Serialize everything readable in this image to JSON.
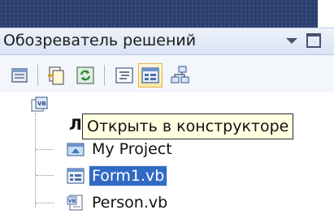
{
  "panel": {
    "title": "Обозреватель решений"
  },
  "toolbar": {
    "buttons": [
      {
        "name": "properties-icon"
      },
      {
        "name": "show-all-files-icon"
      },
      {
        "name": "refresh-icon"
      },
      {
        "name": "view-code-icon"
      },
      {
        "name": "view-designer-icon",
        "active": true
      },
      {
        "name": "class-diagram-icon"
      }
    ]
  },
  "tooltip": {
    "text": "Открыть в конструкторе"
  },
  "tree": {
    "root": {
      "label": "Л",
      "icon": "vb-project-icon"
    },
    "items": [
      {
        "label": "My Project",
        "icon": "my-project-icon",
        "selected": false
      },
      {
        "label": "Form1.vb",
        "icon": "form-icon",
        "selected": true
      },
      {
        "label": "Person.vb",
        "icon": "vb-class-icon",
        "selected": false
      }
    ]
  },
  "colors": {
    "selection": "#316ac5",
    "tooltip_bg": "#ffffe1",
    "header_bg": "#dde6f5"
  }
}
